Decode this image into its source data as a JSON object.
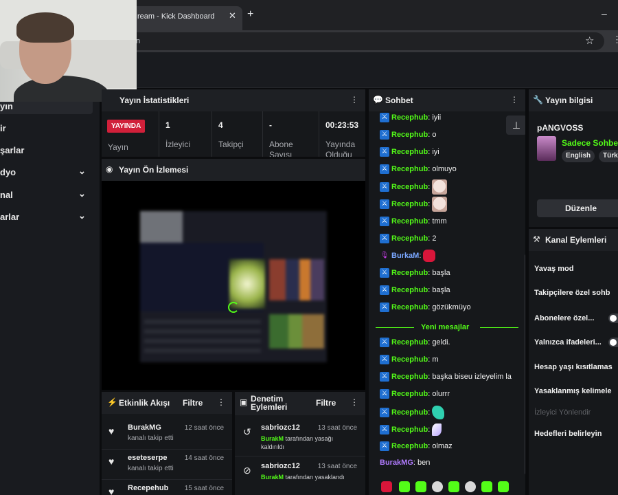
{
  "browser": {
    "tab_title": "ream - Kick Dashboard",
    "tab_close": "✕",
    "new_tab": "+",
    "minimize": "–",
    "url_text": "n",
    "bookmark_star": "☆",
    "menu": "⋮"
  },
  "sidebar": {
    "items": [
      {
        "label": "yın",
        "active": true
      },
      {
        "label": "ir"
      },
      {
        "label": "şarlar"
      },
      {
        "label": "dyo",
        "chevron": "chevron-down-icon"
      },
      {
        "label": "nal",
        "chevron": "chevron-down-icon"
      },
      {
        "label": "arlar",
        "chevron": "chevron-down-icon"
      }
    ]
  },
  "stats": {
    "title": "Yayın İstatistikleri",
    "live_badge": "YAYINDA",
    "live_label": "Yayın",
    "viewers_value": "1",
    "viewers_label": "İzleyici",
    "followers_value": "4",
    "followers_label": "Takipçi",
    "subs_value": "-",
    "subs_label": "Abone",
    "subs_label2": "Sayısı",
    "uptime_value": "00:23:53",
    "uptime_label": "Yayında",
    "uptime_label2": "Olduğu"
  },
  "preview": {
    "title": "Yayın Ön İzlemesi"
  },
  "activity": {
    "title": "Etkinlik Akışı",
    "filter": "Filtre",
    "items": [
      {
        "name": "BurakMG",
        "time": "12 saat önce",
        "sub": "kanalı takip etti"
      },
      {
        "name": "eseteserpe",
        "time": "14 saat önce",
        "sub": "kanalı takip etti"
      },
      {
        "name": "Recepehub",
        "time": "15 saat önce",
        "sub": ""
      }
    ]
  },
  "moderation": {
    "title_line1": "Denetim",
    "title_line2": "Eylemleri",
    "filter": "Filtre",
    "items": [
      {
        "name": "sabriozc12",
        "time": "13 saat önce",
        "user": "BurakM",
        "desc": " tarafından yasağı kaldırıldı"
      },
      {
        "name": "sabriozc12",
        "time": "13 saat önce",
        "user": "BurakM",
        "desc": " tarafından yasaklandı"
      }
    ]
  },
  "chat": {
    "title": "Sohbet",
    "new_messages": "Yeni mesajlar",
    "pin": "📌",
    "messages": [
      {
        "user": "Recephub",
        "text": "iyii"
      },
      {
        "user": "Recephub",
        "text": "o"
      },
      {
        "user": "Recephub",
        "text": "iyi"
      },
      {
        "user": "Recephub",
        "text": "olmuyo"
      },
      {
        "user": "Recephub",
        "text": "",
        "emote": "cat-emote"
      },
      {
        "user": "Recephub",
        "text": "",
        "emote": "cat-emote"
      },
      {
        "user": "Recephub",
        "text": "tmm"
      },
      {
        "user": "Recephub",
        "text": "2"
      },
      {
        "user": "BurkaM",
        "text": "",
        "emote": "red-emote"
      },
      {
        "user": "Recephub",
        "text": "başla"
      },
      {
        "user": "Recephub",
        "text": "başla"
      },
      {
        "user": "Recephub",
        "text": "gözükmüyo"
      },
      {
        "user": "Recephub",
        "text": "geldi."
      },
      {
        "user": "Recephub",
        "text": "m"
      },
      {
        "user": "Recephub",
        "text": "başka biseu izleyelim la"
      },
      {
        "user": "Recephub",
        "text": "olurrr"
      },
      {
        "user": "Recephub",
        "text": "",
        "emote": "teal-emote"
      },
      {
        "user": "Recephub",
        "text": "",
        "emote": "feather-emote"
      },
      {
        "user": "Recephub",
        "text": "olmaz"
      },
      {
        "user": "BurakMG",
        "text": "ben"
      }
    ]
  },
  "stream_info": {
    "title": "Yayın bilgisi",
    "channel": "pANGVOSS",
    "stream_title": "Sadece Sohbet",
    "tags": [
      "English",
      "Türk"
    ],
    "edit": "Düzenle"
  },
  "channel_actions": {
    "title": "Kanal Eylemleri",
    "items": [
      {
        "label": "Yavaş mod"
      },
      {
        "label": "Takipçilere özel sohb"
      },
      {
        "label": "Abonelere özel...",
        "toggle": true
      },
      {
        "label": "Yalnızca ifadeleri...",
        "toggle": true
      },
      {
        "label": "Hesap yaşı kısıtlamas"
      },
      {
        "label": "Yasaklanmış kelimele"
      },
      {
        "label": "İzleyici Yönlendir",
        "disabled": true
      },
      {
        "label": "Hedefleri belirleyin"
      }
    ]
  },
  "colors": {
    "accent": "#53fc18",
    "live": "#d1203a",
    "panel": "#16181b"
  }
}
